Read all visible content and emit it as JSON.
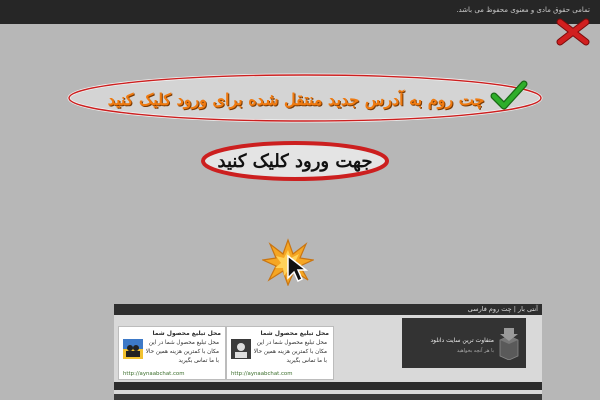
{
  "top_bar": {
    "notice": "تمامی حقوق مادی و معنوی محفوظ می باشد."
  },
  "banner": {
    "text": "چت روم به آدرس جدید منتقل شده برای ورود کلیک کنید"
  },
  "enter_button": {
    "text": "جهت ورود کلیک کنید"
  },
  "panel": {
    "title": "آنتی بار | چت روم فارسی",
    "ads": [
      {
        "title": "محل تبلیغ محصول شما",
        "body": "محل تبلیغ محصول شما در این مکان با کمترین هزینه همین حالا با ما تماس بگیرید",
        "url": "http://aynaabchat.com"
      },
      {
        "title": "محل تبلیغ محصول شما",
        "body": "محل تبلیغ محصول شما در این مکان با کمترین هزینه همین حالا با ما تماس بگیرید",
        "url": "http://aynaabchat.com"
      }
    ],
    "downloads": {
      "title": "متفاوت ترین سایت دانلود",
      "subtitle": "با هر آنچه بخواهید"
    }
  },
  "colors": {
    "background": "#b7b7b7",
    "top_bar": "#262626",
    "banner_text": "#ef7a10",
    "oval_border": "#cc1f1f",
    "close_icon": "#d11f1f",
    "check_icon": "#2fae2a"
  },
  "icons": [
    "close-icon",
    "check-icon",
    "burst-icon",
    "cursor-icon",
    "users-icon",
    "download-box-icon"
  ]
}
